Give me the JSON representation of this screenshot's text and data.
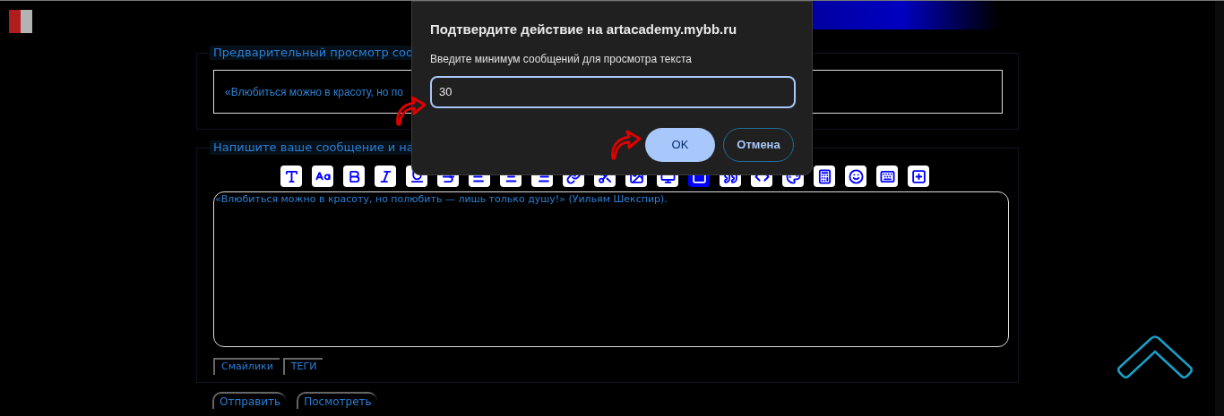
{
  "preview": {
    "legend": "Предварительный просмотр соо",
    "text": "«Влюбиться можно в красоту, но по"
  },
  "compose": {
    "legend": "Напишите ваше сообщение и на",
    "message": "«Влюбиться можно в красоту, но полюбить — лишь только душу!» (Уильям Шекспир).",
    "tabs": [
      {
        "label": "Смайлики",
        "selected": false
      },
      {
        "label": "ТЕГИ",
        "selected": false
      }
    ]
  },
  "buttons": [
    "Отправить",
    "Посмотреть"
  ],
  "dialog": {
    "title": "Подтвердите действие на artacademy.mybb.ru",
    "prompt": "Введите минимум сообщений для просмотра текста",
    "value": "30",
    "ok": "OK",
    "cancel": "Отмена"
  }
}
